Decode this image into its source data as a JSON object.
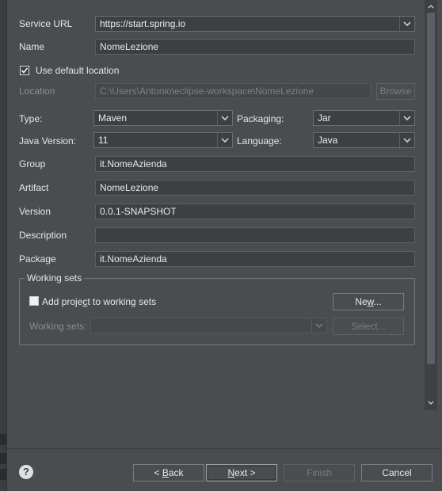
{
  "form": {
    "service_url_label": "Service URL",
    "service_url_value": "https://start.spring.io",
    "name_label": "Name",
    "name_value": "NomeLezione",
    "use_default_location_label": "Use default location",
    "use_default_location_checked": true,
    "location_label": "Location",
    "location_value": "C:\\Users\\Antonio\\eclipse-workspace\\NomeLezione",
    "browse_label": "Browse",
    "type_label": "Type:",
    "type_value": "Maven",
    "packaging_label": "Packaging:",
    "packaging_value": "Jar",
    "java_version_label": "Java Version:",
    "java_version_value": "11",
    "language_label": "Language:",
    "language_value": "Java",
    "group_label": "Group",
    "group_value": "it.NomeAzienda",
    "artifact_label": "Artifact",
    "artifact_value": "NomeLezione",
    "version_label": "Version",
    "version_value": "0.0.1-SNAPSHOT",
    "description_label": "Description",
    "description_value": "",
    "package_label": "Package",
    "package_value": "it.NomeAzienda"
  },
  "working_sets": {
    "title": "Working sets",
    "add_label_pre": "Add proje",
    "add_label_mnemonic": "c",
    "add_label_post": "t to working sets",
    "add_checked": false,
    "new_label_pre": "Ne",
    "new_label_mnemonic": "w",
    "new_label_post": "...",
    "sets_label": "Working sets:",
    "sets_value": "",
    "select_label": "Select..."
  },
  "footer": {
    "help_glyph": "?",
    "back_pre": "< ",
    "back_mnemonic": "B",
    "back_post": "ack",
    "next_mnemonic": "N",
    "next_post": "ext >",
    "finish_label": "Finish",
    "cancel_label": "Cancel"
  },
  "icons": {
    "combo_arrow": "chevron-down-icon",
    "check": "checkmark-icon",
    "help": "help-icon"
  },
  "colors": {
    "background": "#4a4d50",
    "field_bg": "#3d4043",
    "text": "#e6e6e6",
    "disabled_text": "#7d8083"
  }
}
